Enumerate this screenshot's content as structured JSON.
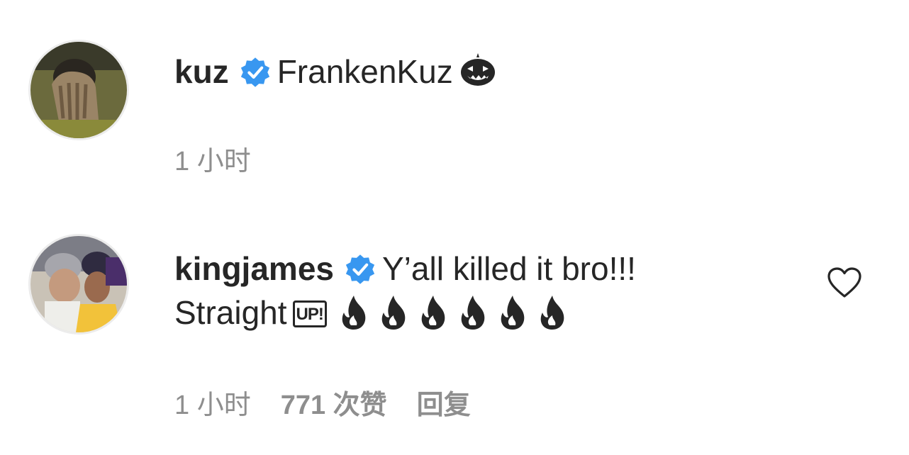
{
  "comments": [
    {
      "username": "kuz",
      "verified": true,
      "text": "FrankenKuz",
      "trailing_emoji": "jack-o-lantern",
      "time": "1 小时"
    },
    {
      "username": "kingjames",
      "verified": true,
      "text_line1": "Y’all killed it bro!!!",
      "text_line2": "Straight",
      "up_badge": "UP!",
      "flame_count": 6,
      "time": "1 小时",
      "likes": "771 次赞",
      "reply_label": "回复",
      "like_icon": "heart-outline-icon"
    }
  ],
  "colors": {
    "text": "#262626",
    "secondary": "#8e8e8e",
    "verified": "#3897f0"
  }
}
